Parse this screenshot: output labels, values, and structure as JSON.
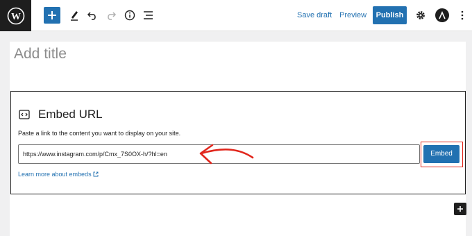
{
  "toolbar": {
    "save_draft": "Save draft",
    "preview": "Preview",
    "publish": "Publish",
    "icons": [
      "wordpress-logo",
      "plus",
      "pencil",
      "undo",
      "redo",
      "info",
      "list-view",
      "settings",
      "user-avatar",
      "more-options"
    ]
  },
  "editor": {
    "title_placeholder": "Add title"
  },
  "embed_block": {
    "title": "Embed URL",
    "description": "Paste a link to the content you want to display on your site.",
    "url_value": "https://www.instagram.com/p/Cmx_7S0OX-h/?hl=en",
    "embed_button": "Embed",
    "learn_more": "Learn more about embeds"
  },
  "colors": {
    "accent": "#2271b1",
    "dark": "#1e1e1e",
    "annotation": "#e1261c"
  }
}
